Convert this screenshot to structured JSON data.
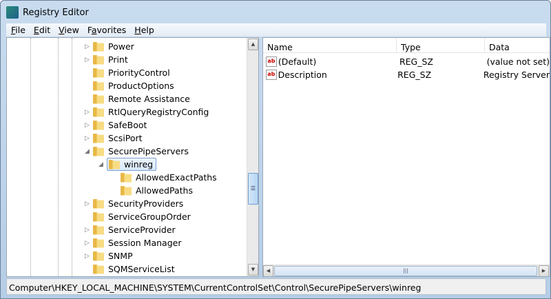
{
  "window": {
    "title": "Registry Editor"
  },
  "menu": [
    {
      "label": "File",
      "key": "F",
      "rest": "ile"
    },
    {
      "label": "Edit",
      "key": "E",
      "rest": "dit"
    },
    {
      "label": "View",
      "key": "V",
      "rest": "iew"
    },
    {
      "label": "Favorites",
      "pre": "F",
      "key": "a",
      "rest": "vorites"
    },
    {
      "label": "Help",
      "key": "H",
      "rest": "elp"
    }
  ],
  "tree": [
    {
      "label": "Power",
      "level": 0,
      "expander": "collapsed"
    },
    {
      "label": "Print",
      "level": 0,
      "expander": "collapsed"
    },
    {
      "label": "PriorityControl",
      "level": 0,
      "expander": "none"
    },
    {
      "label": "ProductOptions",
      "level": 0,
      "expander": "none"
    },
    {
      "label": "Remote Assistance",
      "level": 0,
      "expander": "none"
    },
    {
      "label": "RtlQueryRegistryConfig",
      "level": 0,
      "expander": "collapsed"
    },
    {
      "label": "SafeBoot",
      "level": 0,
      "expander": "collapsed"
    },
    {
      "label": "ScsiPort",
      "level": 0,
      "expander": "collapsed"
    },
    {
      "label": "SecurePipeServers",
      "level": 0,
      "expander": "expanded"
    },
    {
      "label": "winreg",
      "level": 1,
      "expander": "expanded",
      "selected": true
    },
    {
      "label": "AllowedExactPaths",
      "level": 2,
      "expander": "none"
    },
    {
      "label": "AllowedPaths",
      "level": 2,
      "expander": "none"
    },
    {
      "label": "SecurityProviders",
      "level": 0,
      "expander": "collapsed"
    },
    {
      "label": "ServiceGroupOrder",
      "level": 0,
      "expander": "none"
    },
    {
      "label": "ServiceProvider",
      "level": 0,
      "expander": "collapsed"
    },
    {
      "label": "Session Manager",
      "level": 0,
      "expander": "collapsed"
    },
    {
      "label": "SNMP",
      "level": 0,
      "expander": "collapsed"
    },
    {
      "label": "SQMServiceList",
      "level": 0,
      "expander": "none"
    }
  ],
  "values": {
    "columns": [
      "Name",
      "Type",
      "Data"
    ],
    "rows": [
      {
        "name": "(Default)",
        "type": "REG_SZ",
        "data": "(value not set)"
      },
      {
        "name": "Description",
        "type": "REG_SZ",
        "data": "Registry Server"
      }
    ]
  },
  "status": "Computer\\HKEY_LOCAL_MACHINE\\SYSTEM\\CurrentControlSet\\Control\\SecurePipeServers\\winreg"
}
